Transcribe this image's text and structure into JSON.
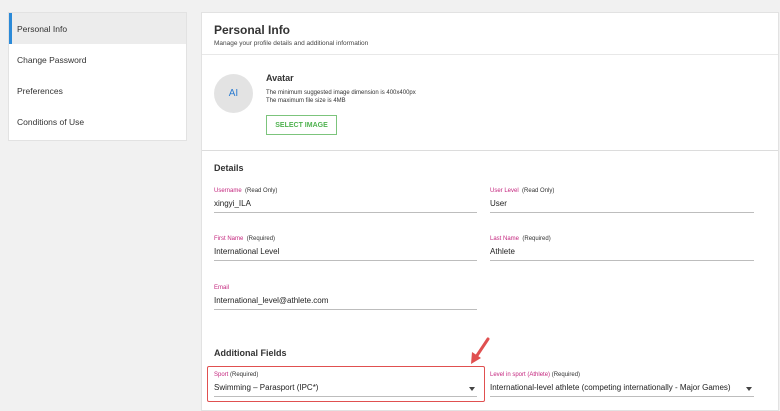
{
  "sidebar": {
    "items": [
      {
        "label": "Personal Info",
        "active": true
      },
      {
        "label": "Change Password"
      },
      {
        "label": "Preferences"
      },
      {
        "label": "Conditions of Use"
      }
    ]
  },
  "header": {
    "title": "Personal Info",
    "subtitle": "Manage your profile details and additional information"
  },
  "avatar": {
    "initials": "AI",
    "label": "Avatar",
    "note1": "The minimum suggested image dimension is 400x400px",
    "note2": "The maximum file size is 4MB",
    "button": "SELECT IMAGE"
  },
  "details": {
    "title": "Details",
    "username": {
      "label": "Username",
      "tag": "(Read Only)",
      "value": "xingyi_ILA"
    },
    "user_level": {
      "label": "User Level",
      "tag": "(Read Only)",
      "value": "User"
    },
    "first_name": {
      "label": "First Name",
      "tag": "(Required)",
      "value": "International Level"
    },
    "last_name": {
      "label": "Last Name",
      "tag": "(Required)",
      "value": "Athlete"
    },
    "email": {
      "label": "Email",
      "value": "International_level@athlete.com"
    }
  },
  "additional": {
    "title": "Additional Fields",
    "sport": {
      "label": "Sport",
      "tag": "(Required)",
      "value": "Swimming – Parasport (IPC*)"
    },
    "level": {
      "label": "Level in sport (Athlete)",
      "tag": "(Required)",
      "value": "International-level athlete (competing internationally - Major Games)"
    }
  },
  "colors": {
    "accent": "#2b8ad8",
    "label": "#c4267e",
    "button": "#4fb24f",
    "annotation": "#e05050"
  }
}
